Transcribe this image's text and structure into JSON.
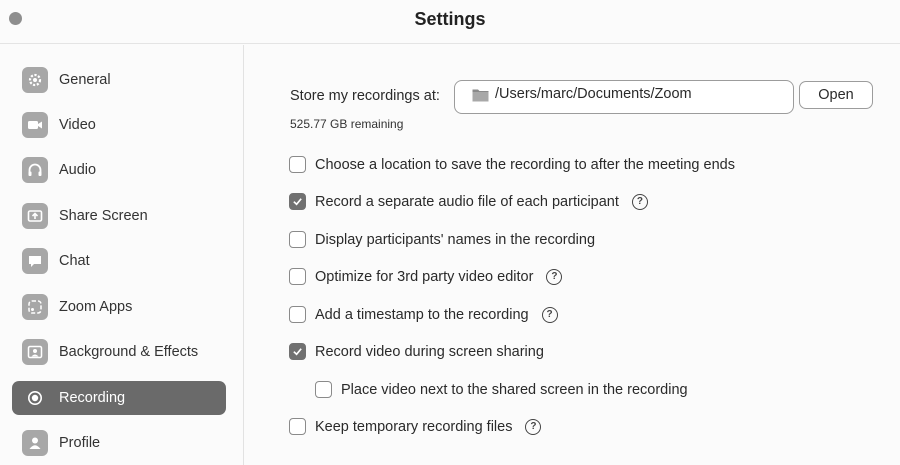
{
  "window": {
    "title": "Settings"
  },
  "sidebar": {
    "items": [
      {
        "label": "General",
        "icon": "gear-icon",
        "active": false
      },
      {
        "label": "Video",
        "icon": "video-camera-icon",
        "active": false
      },
      {
        "label": "Audio",
        "icon": "headphones-icon",
        "active": false
      },
      {
        "label": "Share Screen",
        "icon": "share-screen-icon",
        "active": false
      },
      {
        "label": "Chat",
        "icon": "chat-bubble-icon",
        "active": false
      },
      {
        "label": "Zoom Apps",
        "icon": "apps-icon",
        "active": false
      },
      {
        "label": "Background & Effects",
        "icon": "person-frame-icon",
        "active": false
      },
      {
        "label": "Recording",
        "icon": "record-icon",
        "active": true
      },
      {
        "label": "Profile",
        "icon": "person-icon",
        "active": false
      }
    ]
  },
  "recording": {
    "store_label": "Store my recordings at:",
    "path": "/Users/marc/Documents/Zoom",
    "open_label": "Open",
    "remaining": "525.77 GB remaining",
    "options": [
      {
        "label": "Choose a location to save the recording to after the meeting ends",
        "checked": false,
        "help": false
      },
      {
        "label": "Record a separate audio file of each participant",
        "checked": true,
        "help": true
      },
      {
        "label": "Display participants' names in the recording",
        "checked": false,
        "help": false
      },
      {
        "label": "Optimize for 3rd party video editor",
        "checked": false,
        "help": true
      },
      {
        "label": "Add a timestamp to the recording",
        "checked": false,
        "help": true
      },
      {
        "label": "Record video during screen sharing",
        "checked": true,
        "help": false
      },
      {
        "label": "Place video next to the shared screen in the recording",
        "checked": false,
        "help": false
      },
      {
        "label": "Keep temporary recording files",
        "checked": false,
        "help": true
      }
    ],
    "help_glyph": "?"
  },
  "colors": {
    "active_nav": "#6a6a6a",
    "checked_box": "#707070",
    "icon_tile": "#a7a7a7"
  }
}
